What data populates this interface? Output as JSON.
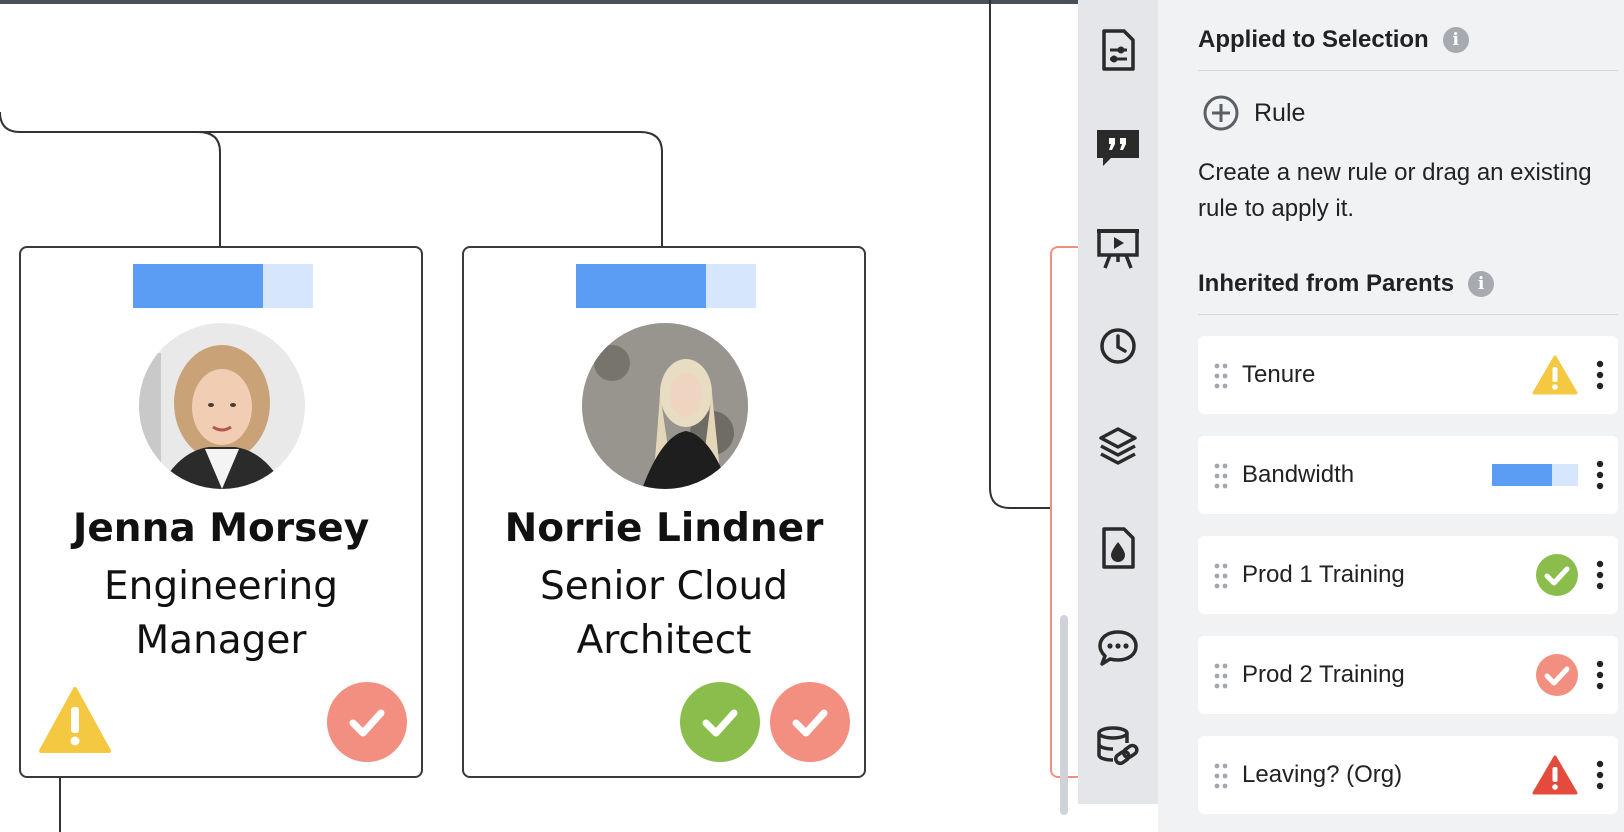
{
  "canvas": {
    "cards": [
      {
        "name": "Jenna Morsey",
        "title_line1": "Engineering",
        "title_line2": "Manager",
        "bandwidth": 0.72,
        "badges": [
          "warning",
          "salmon-check"
        ]
      },
      {
        "name": "Norrie Lindner",
        "title_line1": "Senior Cloud",
        "title_line2": "Architect",
        "bandwidth": 0.72,
        "badges": [
          "green-check",
          "salmon-check"
        ]
      }
    ]
  },
  "rail": {
    "icons": [
      "document-settings-icon",
      "quote-icon",
      "presentation-icon",
      "clock-icon",
      "layers-icon",
      "fill-document-icon",
      "comment-icon",
      "data-link-icon"
    ]
  },
  "panel": {
    "applied_title": "Applied to Selection",
    "add_rule_label": "Rule",
    "help_text": "Create a new rule or drag an existing rule to apply it.",
    "inherited_title": "Inherited from Parents",
    "rules": [
      {
        "label": "Tenure",
        "indicator": "warning-yellow"
      },
      {
        "label": "Bandwidth",
        "indicator": "bar",
        "value": 0.7
      },
      {
        "label": "Prod 1 Training",
        "indicator": "check-green"
      },
      {
        "label": "Prod 2 Training",
        "indicator": "check-salmon"
      },
      {
        "label": "Leaving? (Org)",
        "indicator": "warning-red"
      }
    ]
  },
  "colors": {
    "bar_fill": "#5b9cf5",
    "bar_track": "#d6e6fd",
    "green": "#8bbd4c",
    "salmon": "#f28f80",
    "yellow": "#f5c842",
    "red": "#e44b3c"
  }
}
